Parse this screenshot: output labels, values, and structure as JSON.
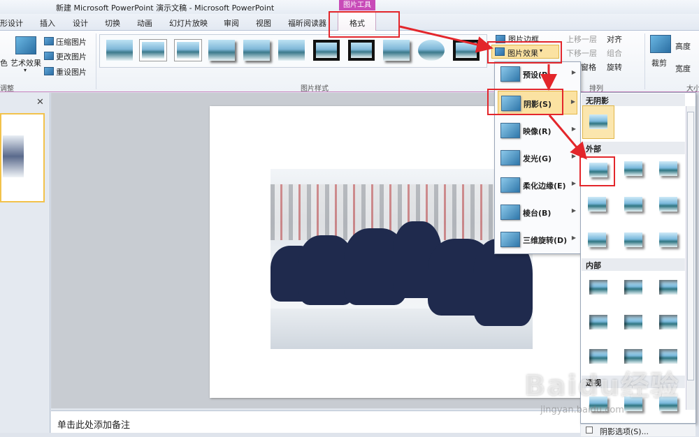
{
  "window": {
    "title": "新建 Microsoft PowerPoint 演示文稿 - Microsoft PowerPoint",
    "context_tab_group": "图片工具"
  },
  "tabs": [
    "形设计",
    "插入",
    "设计",
    "切换",
    "动画",
    "幻灯片放映",
    "审阅",
    "视图",
    "福昕阅读器"
  ],
  "active_tab": "格式",
  "ribbon": {
    "adjust": {
      "artistic_effects": "艺术效果",
      "compress": "压缩图片",
      "change": "更改图片",
      "reset": "重设图片",
      "caption": "调整",
      "partial_left": "色"
    },
    "picture_styles": {
      "caption": "图片样式"
    },
    "picture_border": "图片边框",
    "picture_effects": "图片效果",
    "arrange": {
      "bring_forward": "上移一层",
      "send_backward": "下移一层",
      "selection_pane": "窗格",
      "align": "对齐",
      "group": "组合",
      "rotate": "旋转",
      "caption": "排列"
    },
    "size": {
      "crop": "裁剪",
      "height": "高度",
      "width": "宽度",
      "caption": "大小"
    }
  },
  "effects_menu": {
    "items": [
      "预设(P)",
      "阴影(S)",
      "映像(R)",
      "发光(G)",
      "柔化边缘(E)",
      "棱台(B)",
      "三维旋转(D)"
    ],
    "highlighted": "阴影(S)"
  },
  "shadow_submenu": {
    "sections": [
      "无阴影",
      "外部",
      "内部",
      "透视"
    ],
    "options": "阴影选项(S)..."
  },
  "notes": {
    "placeholder": "单击此处添加备注"
  },
  "watermark": {
    "brand": "Baidu经验",
    "url": "jingyan.baidu.com"
  },
  "colors": {
    "context_tab": "#c84bb8",
    "highlight": "#fbe2a2",
    "annotation": "#e3262b"
  }
}
